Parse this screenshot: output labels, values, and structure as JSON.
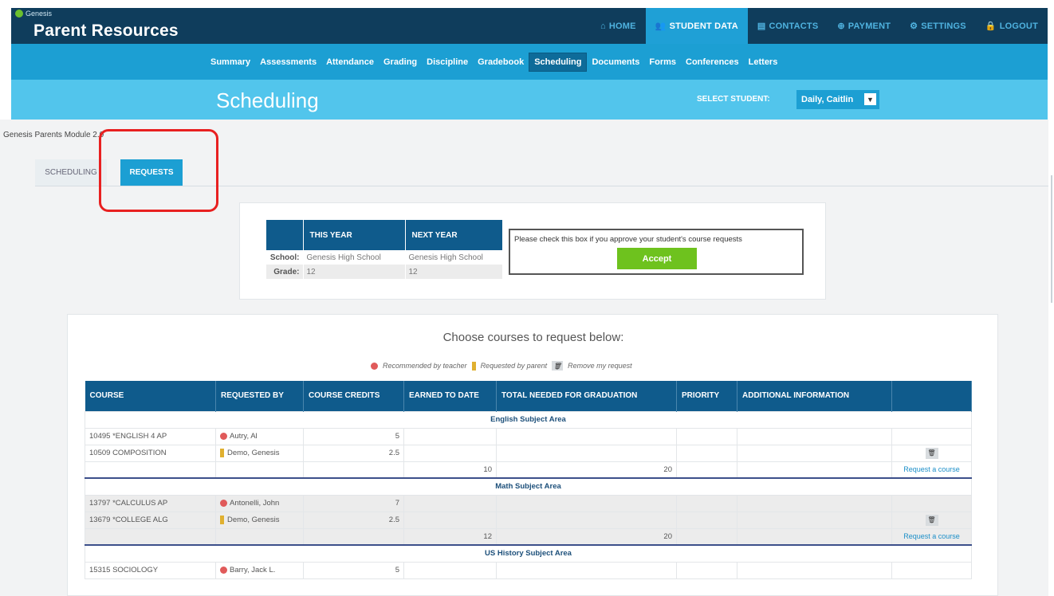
{
  "header": {
    "brand_small": "Genesis",
    "title": "Parent Resources",
    "nav": [
      {
        "icon": "home-icon",
        "glyph": "⌂",
        "label": "HOME"
      },
      {
        "icon": "student-data-icon",
        "glyph": "👥",
        "label": "STUDENT DATA"
      },
      {
        "icon": "contacts-icon",
        "glyph": "▤",
        "label": "CONTACTS"
      },
      {
        "icon": "payment-icon",
        "glyph": "⊕",
        "label": "PAYMENT"
      },
      {
        "icon": "settings-icon",
        "glyph": "⚙",
        "label": "SETTINGS"
      },
      {
        "icon": "lock-icon",
        "glyph": "🔒",
        "label": "LOGOUT"
      }
    ],
    "active_nav": "STUDENT DATA"
  },
  "subnav": [
    "Summary",
    "Assessments",
    "Attendance",
    "Grading",
    "Discipline",
    "Gradebook",
    "Scheduling",
    "Documents",
    "Forms",
    "Conferences",
    "Letters"
  ],
  "subnav_active": "Scheduling",
  "page": {
    "title": "Scheduling",
    "select_label": "SELECT STUDENT:",
    "student": "Daily, Caitlin",
    "breadcrumb": "Genesis Parents Module 2.0"
  },
  "tabs": {
    "scheduling": "SCHEDULING",
    "requests": "REQUESTS"
  },
  "info": {
    "headers": [
      "",
      "THIS YEAR",
      "NEXT YEAR"
    ],
    "rows": [
      {
        "label": "School:",
        "this_year": "Genesis High School",
        "next_year": "Genesis High School"
      },
      {
        "label": "Grade:",
        "this_year": "12",
        "next_year": "12"
      }
    ],
    "approve_text": "Please check this box if you approve your student's course requests",
    "accept_label": "Accept"
  },
  "courses": {
    "heading": "Choose courses to request below:",
    "legend": {
      "recommended": "Recommended by teacher",
      "requested": "Requested by parent",
      "remove": "Remove my request"
    },
    "columns": [
      "COURSE",
      "REQUESTED BY",
      "COURSE CREDITS",
      "EARNED TO DATE",
      "TOTAL NEEDED FOR GRADUATION",
      "PRIORITY",
      "ADDITIONAL INFORMATION",
      ""
    ],
    "request_link": "Request a course",
    "areas": [
      {
        "name": "English Subject Area",
        "rows": [
          {
            "code": "10495",
            "name": "*ENGLISH 4 AP",
            "by": "Autry, Al",
            "type": "teacher",
            "credits": "5"
          },
          {
            "code": "10509",
            "name": "COMPOSITION",
            "by": "Demo, Genesis",
            "type": "parent",
            "credits": "2.5"
          }
        ],
        "earned": "10",
        "needed": "20"
      },
      {
        "name": "Math Subject Area",
        "rows": [
          {
            "code": "13797",
            "name": "*CALCULUS AP",
            "by": "Antonelli, John",
            "type": "teacher",
            "credits": "7"
          },
          {
            "code": "13679",
            "name": "*COLLEGE ALG",
            "by": "Demo, Genesis",
            "type": "parent",
            "credits": "2.5"
          }
        ],
        "earned": "12",
        "needed": "20"
      },
      {
        "name": "US History Subject Area",
        "rows": [
          {
            "code": "15315",
            "name": "SOCIOLOGY",
            "by": "Barry, Jack L.",
            "type": "teacher",
            "credits": "5"
          }
        ]
      }
    ]
  }
}
